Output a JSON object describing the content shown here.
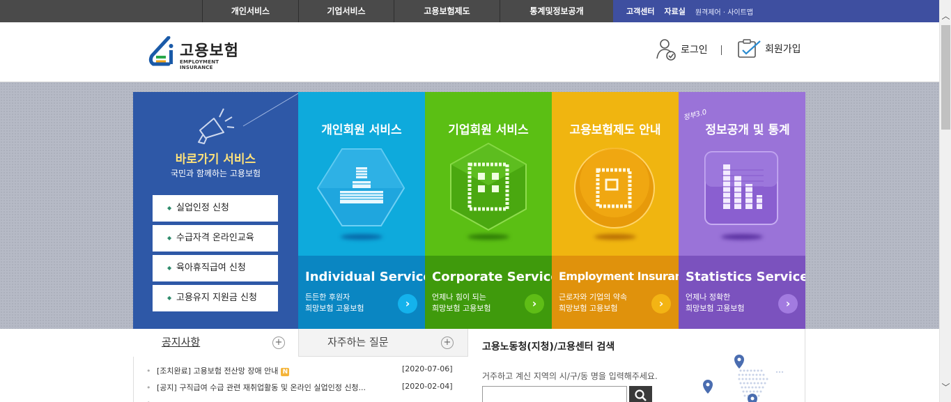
{
  "topnav": {
    "menu": [
      "개인서비스",
      "기업서비스",
      "고용보험제도",
      "통계및정보공개"
    ],
    "util_bold": [
      "고객센터",
      "자료실"
    ],
    "util_small": "원격제어 · 사이트맵"
  },
  "header": {
    "logo_ko": "고용보험",
    "logo_en": "EMPLOYMENT INSURANCE",
    "login": "로그인",
    "join": "회원가입"
  },
  "quick": {
    "title": "바로가기 서비스",
    "subtitle": "국민과 함께하는 고용보험",
    "buttons": [
      "실업인정 신청",
      "수급자격 온라인교육",
      "육아휴직급여 신청",
      "고용유지 지원금 신청"
    ]
  },
  "cards": [
    {
      "head": "개인회원 서비스",
      "en": "Individual Service",
      "desc1": "든든한 후원자",
      "desc2": "희망보험 고용보험",
      "color": "#0eaadc",
      "foot": "#0a86c2"
    },
    {
      "head": "기업회원 서비스",
      "en": "Corporate Service",
      "desc1": "언제나 힘이 되는",
      "desc2": "희망보험 고용보험",
      "color": "#5bbf14",
      "foot": "#3f9a0c"
    },
    {
      "head": "고용보험제도 안내",
      "en": "Employment Insurance",
      "desc1": "근로자와 기업의 약속",
      "desc2": "희망보험 고용보험",
      "color": "#f0b510",
      "foot": "#e0920c"
    },
    {
      "head": "정보공개 및 통계",
      "en": "Statistics Service",
      "desc1": "언제나 정확한",
      "desc2": "희망보험 고용보험",
      "color": "#9a73d8",
      "foot": "#7b52be",
      "badge": "정부3.0"
    }
  ],
  "tabs": {
    "notice": "공지사항",
    "faq": "자주하는 질문"
  },
  "notices": [
    {
      "text": "[조치완료] 고용보험 전산망 장애 안내",
      "date": "[2020-07-06]",
      "new": "N"
    },
    {
      "text": "[공지] 구직급여 수급 관련 재취업활동 및 온라인 실업인정 신청...",
      "date": "[2020-02-04]"
    }
  ],
  "search": {
    "title": "고용노동청(지청)/고용센터 검색",
    "hint": "거주하고 계신 지역의 시/구/동 명을 입력해주세요."
  }
}
